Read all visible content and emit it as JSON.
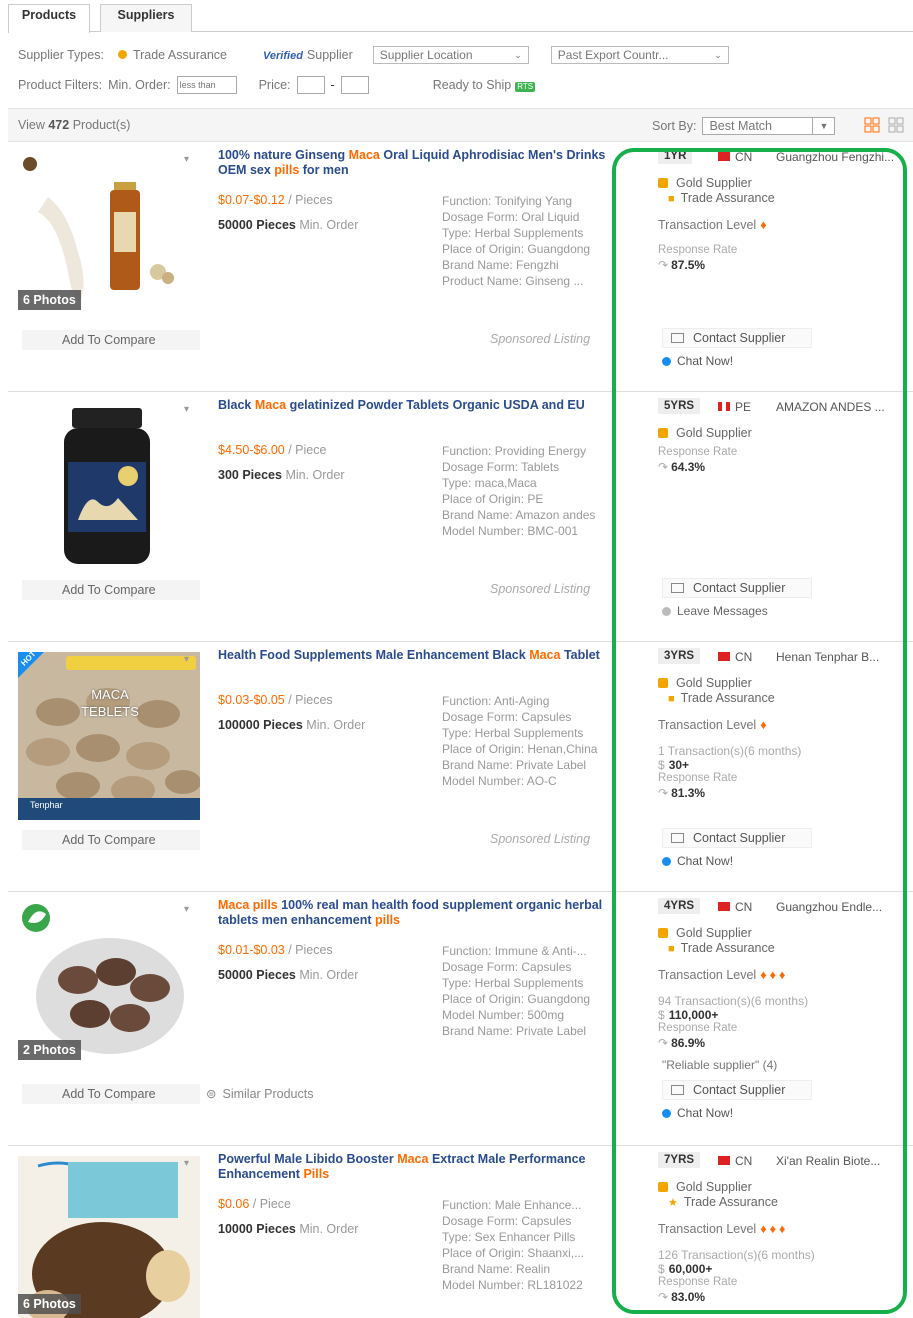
{
  "tabs": [
    "Products",
    "Suppliers"
  ],
  "filters": {
    "supplier_types_label": "Supplier Types:",
    "trade_assurance": "Trade Assurance",
    "verified": "Verified",
    "verified_supplier": "Supplier",
    "supplier_location": "Supplier Location",
    "past_export": "Past Export Countr...",
    "product_filters_label": "Product Filters:",
    "min_order_label": "Min. Order:",
    "min_order_placeholder": "less than",
    "price_label": "Price:",
    "ready_to_ship": "Ready to Ship",
    "rts_badge": "RTS"
  },
  "view": {
    "prefix": "View",
    "count": "472",
    "suffix": "Product(s)",
    "sort_label": "Sort By:",
    "sort_value": "Best Match"
  },
  "common": {
    "add_to_compare": "Add To Compare",
    "sponsored": "Sponsored Listing",
    "similar": "Similar Products",
    "min_order": "Min. Order",
    "gold_supplier": "Gold Supplier",
    "trade_assurance": "Trade Assurance",
    "transaction_level": "Transaction Level",
    "response_rate": "Response Rate",
    "contact_supplier": "Contact Supplier",
    "chat_now": "Chat Now!",
    "leave_messages": "Leave Messages"
  },
  "products": [
    {
      "title_parts": [
        "100% nature Ginseng ",
        "Maca",
        " Oral Liquid Aphrodisiac Men's Drinks OEM sex ",
        "pills",
        " for men"
      ],
      "price": "$0.07-$0.12",
      "unit": "/ Pieces",
      "moq": "50000 Pieces",
      "attrs": [
        "Function: Tonifying Yang",
        "Dosage Form: Oral Liquid",
        "Type: Herbal Supplements",
        "Place of Origin: Guangdong",
        "Brand Name: Fengzhi",
        "Product Name: Ginseng ..."
      ],
      "photos": "6 Photos",
      "years": "1YR",
      "country": "CN",
      "supplier_name": "Guangzhou Fengzhi...",
      "transactions": "",
      "amount": "",
      "response_rate": "87.5%",
      "reliable": ""
    },
    {
      "title_parts": [
        "Black ",
        "Maca",
        " gelatinized Powder Tablets Organic USDA and EU",
        "",
        ""
      ],
      "price": "$4.50-$6.00",
      "unit": "/ Piece",
      "moq": "300 Pieces",
      "attrs": [
        "Function: Providing Energy",
        "Dosage Form: Tablets",
        "Type: maca,Maca",
        "Place of Origin: PE",
        "Brand Name: Amazon andes",
        "Model Number: BMC-001"
      ],
      "photos": "",
      "years": "5YRS",
      "country": "PE",
      "supplier_name": "AMAZON ANDES ...",
      "transactions": "",
      "amount": "",
      "response_rate": "64.3%",
      "reliable": ""
    },
    {
      "title_parts": [
        "Health Food Supplements Male Enhancement Black ",
        "Maca",
        " Tablet",
        "",
        ""
      ],
      "price": "$0.03-$0.05",
      "unit": "/ Pieces",
      "moq": "100000 Pieces",
      "attrs": [
        "Function: Anti-Aging",
        "Dosage Form: Capsules",
        "Type: Herbal Supplements",
        "Place of Origin: Henan,China",
        "Brand Name: Private Label",
        "Model Number: AO-C"
      ],
      "photos": "",
      "years": "3YRS",
      "country": "CN",
      "supplier_name": "Henan Tenphar B...",
      "transactions": "1 Transaction(s)(6 months)",
      "amount": "30+",
      "response_rate": "81.3%",
      "reliable": "",
      "image_label": "MACA TEBLETS",
      "brand": "Tenphar",
      "hot": "HOT"
    },
    {
      "title_parts": [
        "",
        "Maca pills",
        " 100% real man health food supplement organic herbal tablets men enhancement ",
        "pills",
        ""
      ],
      "price": "$0.01-$0.03",
      "unit": "/ Pieces",
      "moq": "50000 Pieces",
      "attrs": [
        "Function: Immune & Anti-...",
        "Dosage Form: Capsules",
        "Type: Herbal Supplements",
        "Place of Origin: Guangdong",
        "Model Number: 500mg",
        "Brand Name: Private Label"
      ],
      "photos": "2 Photos",
      "years": "4YRS",
      "country": "CN",
      "supplier_name": "Guangzhou Endle...",
      "transactions": "94 Transaction(s)(6 months)",
      "amount": "110,000+",
      "response_rate": "86.9%",
      "reliable": "\"Reliable supplier\" (4)"
    },
    {
      "title_parts": [
        "Powerful Male Libido Booster ",
        "Maca",
        " Extract Male Performance Enhancement ",
        "Pills",
        ""
      ],
      "price": "$0.06",
      "unit": "/ Piece",
      "moq": "10000 Pieces",
      "attrs": [
        "Function: Male Enhance...",
        "Dosage Form: Capsules",
        "Type: Sex Enhancer Pills",
        "Place of Origin: Shaanxi,...",
        "Brand Name: Realin",
        "Model Number: RL181022"
      ],
      "photos": "6 Photos",
      "years": "7YRS",
      "country": "CN",
      "supplier_name": "Xi'an Realin Biote...",
      "transactions": "126 Transaction(s)(6 months)",
      "amount": "60,000+",
      "response_rate": "83.0%",
      "reliable": ""
    }
  ],
  "colors": {
    "accent": "#ff6a00",
    "title": "#2a4b8d",
    "gold": "#f0a500",
    "highlight": "#16b04a"
  }
}
